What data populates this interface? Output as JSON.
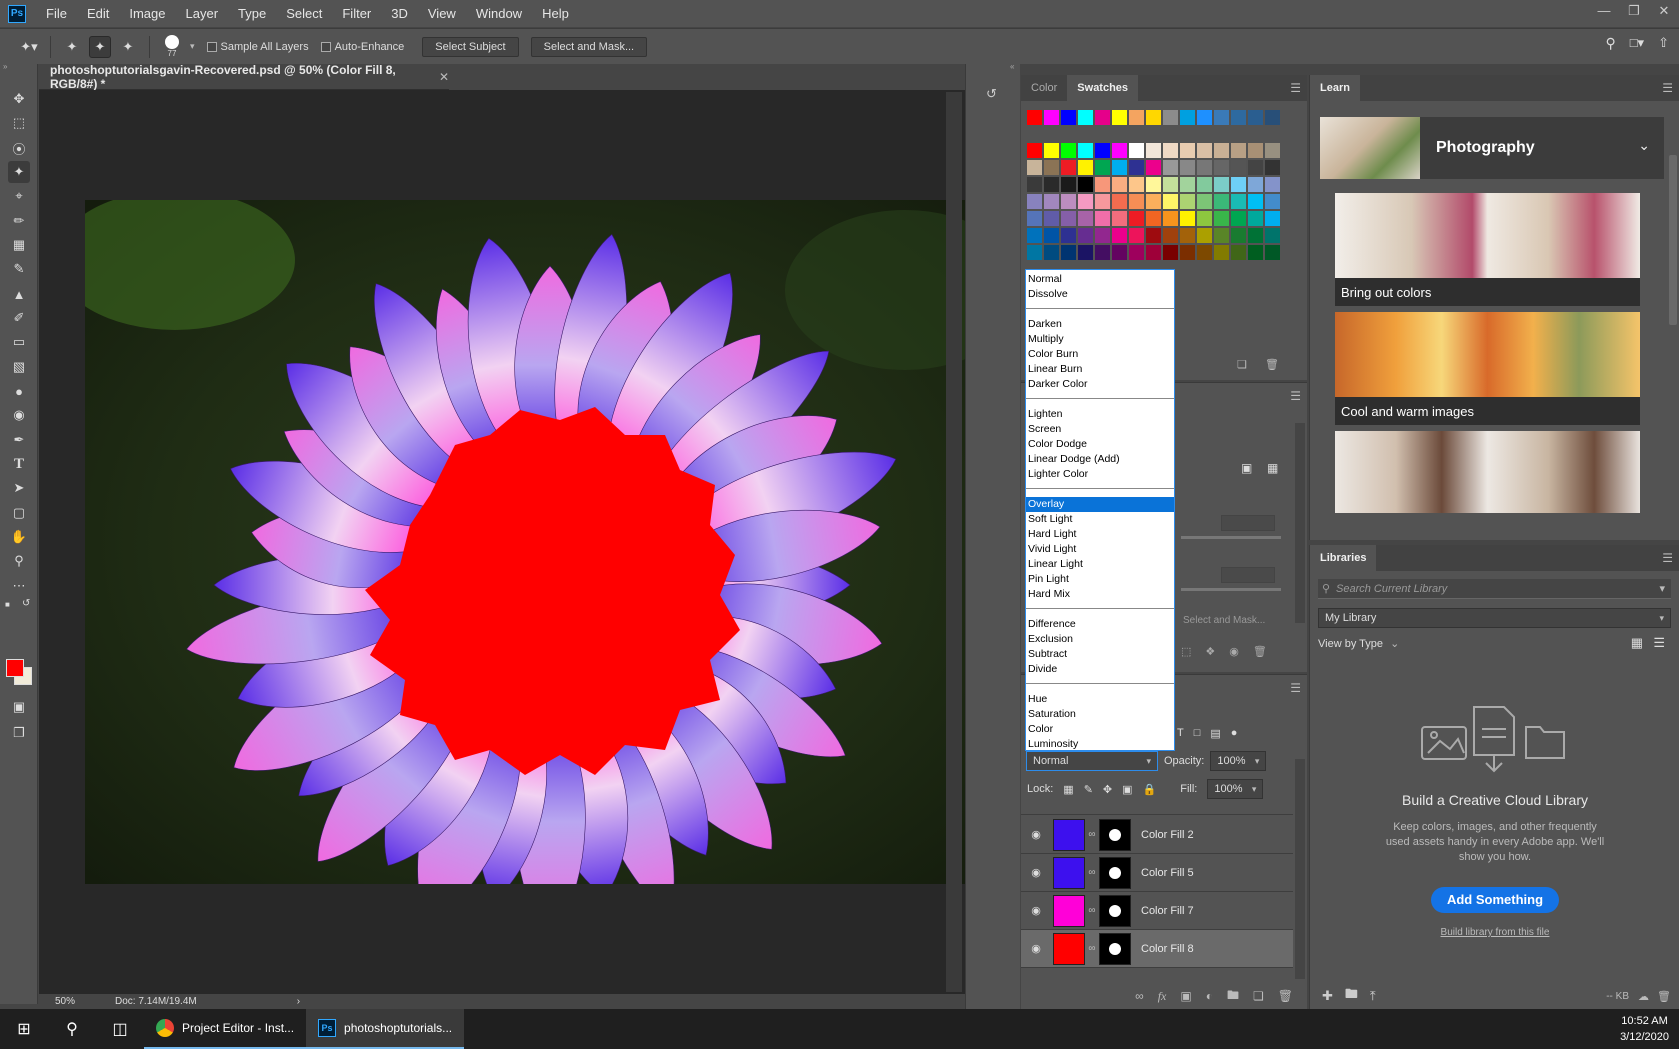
{
  "menubar": {
    "logo": "Ps",
    "items": [
      "File",
      "Edit",
      "Image",
      "Layer",
      "Type",
      "Select",
      "Filter",
      "3D",
      "View",
      "Window",
      "Help"
    ]
  },
  "optionsbar": {
    "brush_size": "77",
    "sample_all_layers": "Sample All Layers",
    "auto_enhance": "Auto-Enhance",
    "select_subject": "Select Subject",
    "select_and_mask": "Select and Mask..."
  },
  "document": {
    "tab_title": "photoshoptutorialsgavin-Recovered.psd @ 50% (Color Fill 8, RGB/8#) *",
    "zoom": "50%",
    "doc_size": "Doc: 7.14M/19.4M"
  },
  "swatches": {
    "tabs": [
      "Color",
      "Swatches"
    ],
    "active_tab": "Swatches",
    "recent": [
      "#ff0000",
      "#ff00ff",
      "#0000ff",
      "#00ffff",
      "#e5008a",
      "#ffff00",
      "#f4a460",
      "#ffd700",
      "#8c8c8c",
      "#00a0e0",
      "#1e90ff",
      "#3a7ab8",
      "#2e6aa0",
      "#2a5e90",
      "#284f78"
    ],
    "grid": [
      "#ff0000",
      "#ffff00",
      "#00ff00",
      "#00ffff",
      "#0000ff",
      "#ff00ff",
      "#ffffff",
      "#f2e6d9",
      "#efd9c4",
      "#e8ccb0",
      "#d9bfa5",
      "#c9b095",
      "#b8a085",
      "#a89075",
      "#989080",
      "#c8b49a",
      "#8b7355",
      "#ed1c24",
      "#fff200",
      "#00a651",
      "#00aeef",
      "#2e3192",
      "#ec008c",
      "#999999",
      "#888888",
      "#777777",
      "#666666",
      "#555555",
      "#444444",
      "#333333",
      "#3a3a3a",
      "#2a2a2a",
      "#1a1a1a",
      "#000000",
      "#f7977a",
      "#f9ad81",
      "#fdc68a",
      "#fff79a",
      "#c4df9b",
      "#a2d39c",
      "#82ca9d",
      "#7bcdc8",
      "#6ecff6",
      "#7ea7d8",
      "#8493ca",
      "#8882be",
      "#a187be",
      "#bc8dbf",
      "#f49ac2",
      "#f6989d",
      "#f26c4f",
      "#f68e55",
      "#fbaf5c",
      "#fff467",
      "#acd372",
      "#7cc576",
      "#3bb878",
      "#1abbb4",
      "#00bff3",
      "#438ccb",
      "#5574b9",
      "#605ca8",
      "#855fa8",
      "#a763a8",
      "#f06ea9",
      "#f26d7d",
      "#ed1c24",
      "#f26522",
      "#f7941d",
      "#fff200",
      "#8dc73f",
      "#39b54a",
      "#00a651",
      "#00a99d",
      "#00aeef",
      "#0072bc",
      "#0054a6",
      "#2e3192",
      "#662d91",
      "#92278f",
      "#ec008c",
      "#ed145b",
      "#9e0b0f",
      "#a0410d",
      "#a3620a",
      "#aba000",
      "#598527",
      "#197b30",
      "#007236",
      "#00746b",
      "#0076a3",
      "#004b80",
      "#003471",
      "#1b1464",
      "#440e62",
      "#630460",
      "#9e005d",
      "#9e0039",
      "#790000",
      "#7b2e00",
      "#7d4900",
      "#827b00",
      "#406618",
      "#005e20",
      "#005826"
    ]
  },
  "blend_modes": {
    "groups": [
      [
        "Normal",
        "Dissolve"
      ],
      [
        "Darken",
        "Multiply",
        "Color Burn",
        "Linear Burn",
        "Darker Color"
      ],
      [
        "Lighten",
        "Screen",
        "Color Dodge",
        "Linear Dodge (Add)",
        "Lighter Color"
      ],
      [
        "Overlay",
        "Soft Light",
        "Hard Light",
        "Vivid Light",
        "Linear Light",
        "Pin Light",
        "Hard Mix"
      ],
      [
        "Difference",
        "Exclusion",
        "Subtract",
        "Divide"
      ],
      [
        "Hue",
        "Saturation",
        "Color",
        "Luminosity"
      ]
    ],
    "highlighted": "Overlay"
  },
  "props": {
    "select_and_mask": "Select and Mask..."
  },
  "layers": {
    "blend_value": "Normal",
    "opacity_label": "Opacity:",
    "opacity_value": "100%",
    "lock_label": "Lock:",
    "fill_label": "Fill:",
    "fill_value": "100%",
    "items": [
      {
        "name": "Color Fill 2",
        "color": "#3d10ee",
        "selected": false
      },
      {
        "name": "Color Fill 5",
        "color": "#3d10ee",
        "selected": false
      },
      {
        "name": "Color Fill 7",
        "color": "#ff00d8",
        "selected": false
      },
      {
        "name": "Color Fill 8",
        "color": "#ff0000",
        "selected": true
      }
    ]
  },
  "learn": {
    "tab": "Learn",
    "topic": "Photography",
    "cards": [
      "Bring out colors",
      "Cool and warm images",
      ""
    ]
  },
  "libraries": {
    "tab": "Libraries",
    "search_placeholder": "Search Current Library",
    "library": "My Library",
    "view_by": "View by Type",
    "empty_title": "Build a Creative Cloud Library",
    "empty_desc": "Keep colors, images, and other frequently used assets handy in every Adobe app. We'll show you how.",
    "add_button": "Add Something",
    "build_link": "Build library from this file",
    "kb": "-- KB"
  },
  "taskbar": {
    "apps": [
      {
        "label": "Project Editor - Inst...",
        "active": false
      },
      {
        "label": "photoshoptutorials...",
        "active": true
      }
    ],
    "time": "10:52 AM",
    "date": "3/12/2020"
  }
}
